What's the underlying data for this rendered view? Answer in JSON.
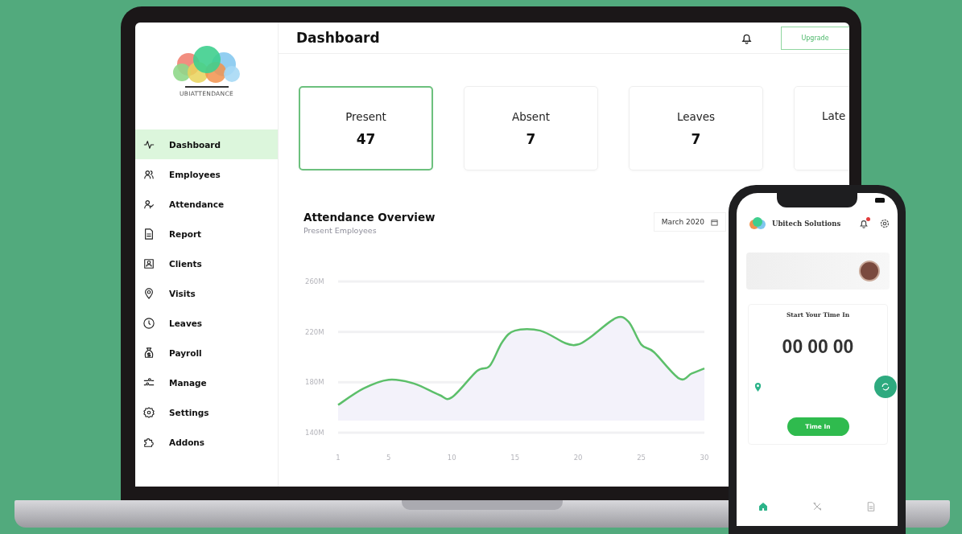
{
  "logo": {
    "text": "UBIATTENDANCE"
  },
  "sidebar": {
    "items": [
      {
        "label": "Dashboard",
        "selected": true
      },
      {
        "label": "Employees",
        "selected": false
      },
      {
        "label": "Attendance",
        "selected": false
      },
      {
        "label": "Report",
        "selected": false
      },
      {
        "label": "Clients",
        "selected": false
      },
      {
        "label": "Visits",
        "selected": false
      },
      {
        "label": "Leaves",
        "selected": false
      },
      {
        "label": "Payroll",
        "selected": false
      },
      {
        "label": "Manage",
        "selected": false
      },
      {
        "label": "Settings",
        "selected": false
      },
      {
        "label": "Addons",
        "selected": false
      }
    ]
  },
  "header": {
    "title": "Dashboard",
    "button": "Upgrade"
  },
  "stats": [
    {
      "label": "Present",
      "value": "47",
      "selected": true
    },
    {
      "label": "Absent",
      "value": "7",
      "selected": false
    },
    {
      "label": "Leaves",
      "value": "7",
      "selected": false
    },
    {
      "label": "Late",
      "selected": false
    }
  ],
  "overview": {
    "title": "Attendance Overview",
    "month": "March 2020",
    "chart_data": {
      "type": "area",
      "x": [
        1,
        3,
        5,
        7,
        9,
        10,
        12,
        13,
        14,
        15,
        17,
        19,
        20,
        21,
        23,
        24,
        25,
        26,
        28,
        29,
        30
      ],
      "series": [
        {
          "name": "Present Employees",
          "color": "#5cbf6a",
          "values": [
            162,
            175,
            182,
            179,
            170,
            168,
            189,
            193,
            212,
            221,
            221,
            211,
            210,
            216,
            231,
            228,
            210,
            204,
            183,
            187,
            191
          ]
        }
      ],
      "xlim": [
        1,
        30
      ],
      "ylim": [
        140,
        260
      ],
      "xticks": [
        1,
        5,
        10,
        15,
        20,
        25,
        30
      ],
      "yticks": [
        {
          "value": 140,
          "label": "140M"
        },
        {
          "value": 180,
          "label": "180M"
        },
        {
          "value": 220,
          "label": "220M"
        },
        {
          "value": 260,
          "label": "260M"
        }
      ]
    }
  },
  "phone": {
    "app_name": "Ubitech Solutions",
    "notification": true,
    "card_title": "Start Your Time In",
    "timer": [
      "00",
      "00",
      "00"
    ],
    "button": "Time In",
    "nav": [
      {
        "selected": true
      },
      {
        "selected": false
      },
      {
        "selected": false
      }
    ]
  }
}
